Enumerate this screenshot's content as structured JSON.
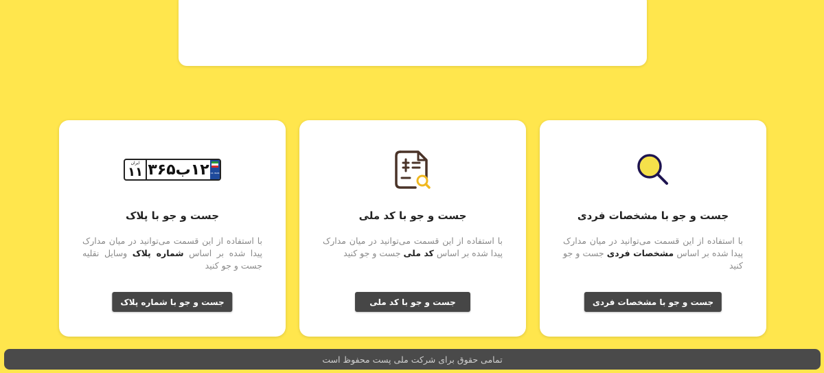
{
  "cards": {
    "personal": {
      "icon": "magnifier-icon",
      "title": "جست و جو با مشخصات فردی",
      "desc_before": "با استفاده از این قسمت می‌توانید در میان مدارک پیدا شده بر اساس",
      "desc_bold": "مشخصات فردی",
      "desc_after": "جست و جو کنید",
      "button": "جست و جو با مشخصات فردی"
    },
    "national_code": {
      "icon": "document-search-icon",
      "title": "جست و جو با کد ملی",
      "desc_before": "با استفاده از این قسمت می‌توانید در میان مدارک پیدا شده بر اساس",
      "desc_bold": "کد ملی",
      "desc_after": "جست و جو کنید",
      "button": "جست و جو با کد ملی"
    },
    "plate": {
      "icon": "license-plate-icon",
      "title": "جست و جو با پلاک",
      "desc_before": "با استفاده از این قسمت می‌توانید در میان مدارک پیدا شده بر اساس",
      "desc_bold": "شماره پلاک",
      "desc_after": "وسایل نقلیه جست و جو کنید",
      "button": "جست و جو با شماره پلاک",
      "plate_main": "۱۲ب۳۶۵",
      "plate_region_label": "ایران",
      "plate_region_num": "۱۱",
      "plate_flag_text": "I.R. IRAN"
    }
  },
  "footer": {
    "text": "تمامی حقوق برای شرکت ملی پست محفوظ است"
  },
  "colors": {
    "background": "#ffe64d",
    "button": "#464646",
    "footer": "#4a4a4a",
    "icon_dark": "#1e1450",
    "icon_fill": "#f5e04a",
    "doc_icon": "#4a3328"
  }
}
